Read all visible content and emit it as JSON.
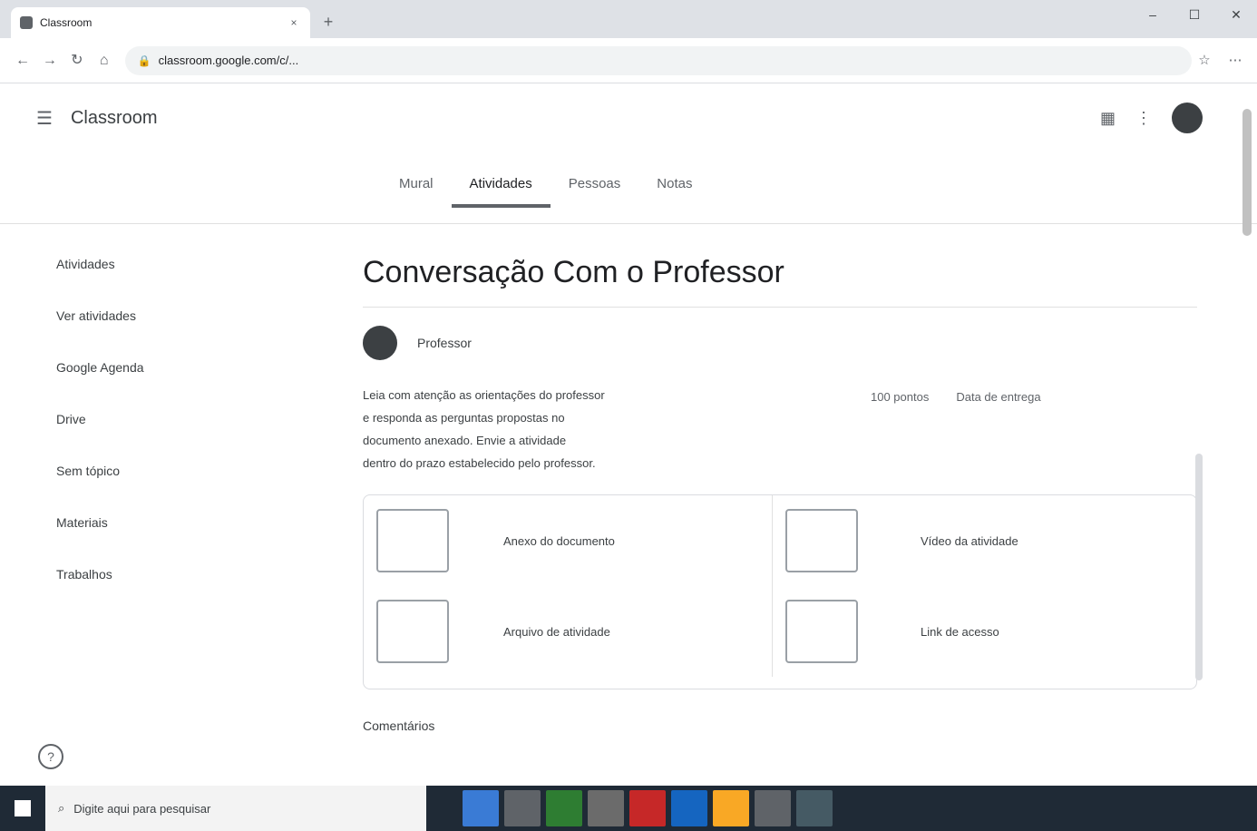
{
  "browser": {
    "tab_title": "Classroom",
    "url": "classroom.google.com/c/...",
    "close_glyph": "×",
    "newtab_glyph": "+"
  },
  "toolbar": {
    "back": "←",
    "forward": "→",
    "reload": "↻",
    "home": "⌂",
    "star": "☆",
    "ext": "⋯"
  },
  "appbar": {
    "menu_glyph": "☰",
    "brand": "Classroom",
    "grid_glyph": "▦",
    "apps_glyph": "⋮"
  },
  "tabs": [
    "Mural",
    "Atividades",
    "Pessoas",
    "Notas"
  ],
  "sidebar": {
    "items": [
      "Atividades",
      "Ver atividades",
      "Google Agenda",
      "Drive",
      "Sem tópico",
      "Materiais",
      "Trabalhos"
    ]
  },
  "main": {
    "title": "Conversação Com o Professor",
    "author": "Professor",
    "date": "",
    "points": [
      "100 pontos",
      "Data de entrega"
    ],
    "description_lines": [
      "Leia com atenção as orientações do professor",
      "e responda as perguntas propostas no",
      "documento anexado. Envie a atividade",
      "dentro do prazo estabelecido pelo professor."
    ],
    "rubric": [
      {
        "label": "",
        "text": "Anexo do documento"
      },
      {
        "label": "",
        "text": "Vídeo da atividade"
      },
      {
        "label": "",
        "text": "Arquivo de atividade"
      },
      {
        "label": "",
        "text": "Link de acesso"
      }
    ],
    "comment": "Comentários"
  },
  "help_glyph": "?",
  "taskbar": {
    "search_placeholder": "Digite aqui para pesquisar",
    "search_icon": "⌕",
    "icons": [
      "#3a7bd5",
      "#5f6368",
      "#2e7d32",
      "#6b6b6b",
      "#c62828",
      "#1565c0",
      "#f9a825",
      "#5f6368",
      "#455a64"
    ],
    "time": "",
    "date": ""
  },
  "colors": {
    "accent": "#5f6368",
    "taskbar": "#1f2a36"
  }
}
